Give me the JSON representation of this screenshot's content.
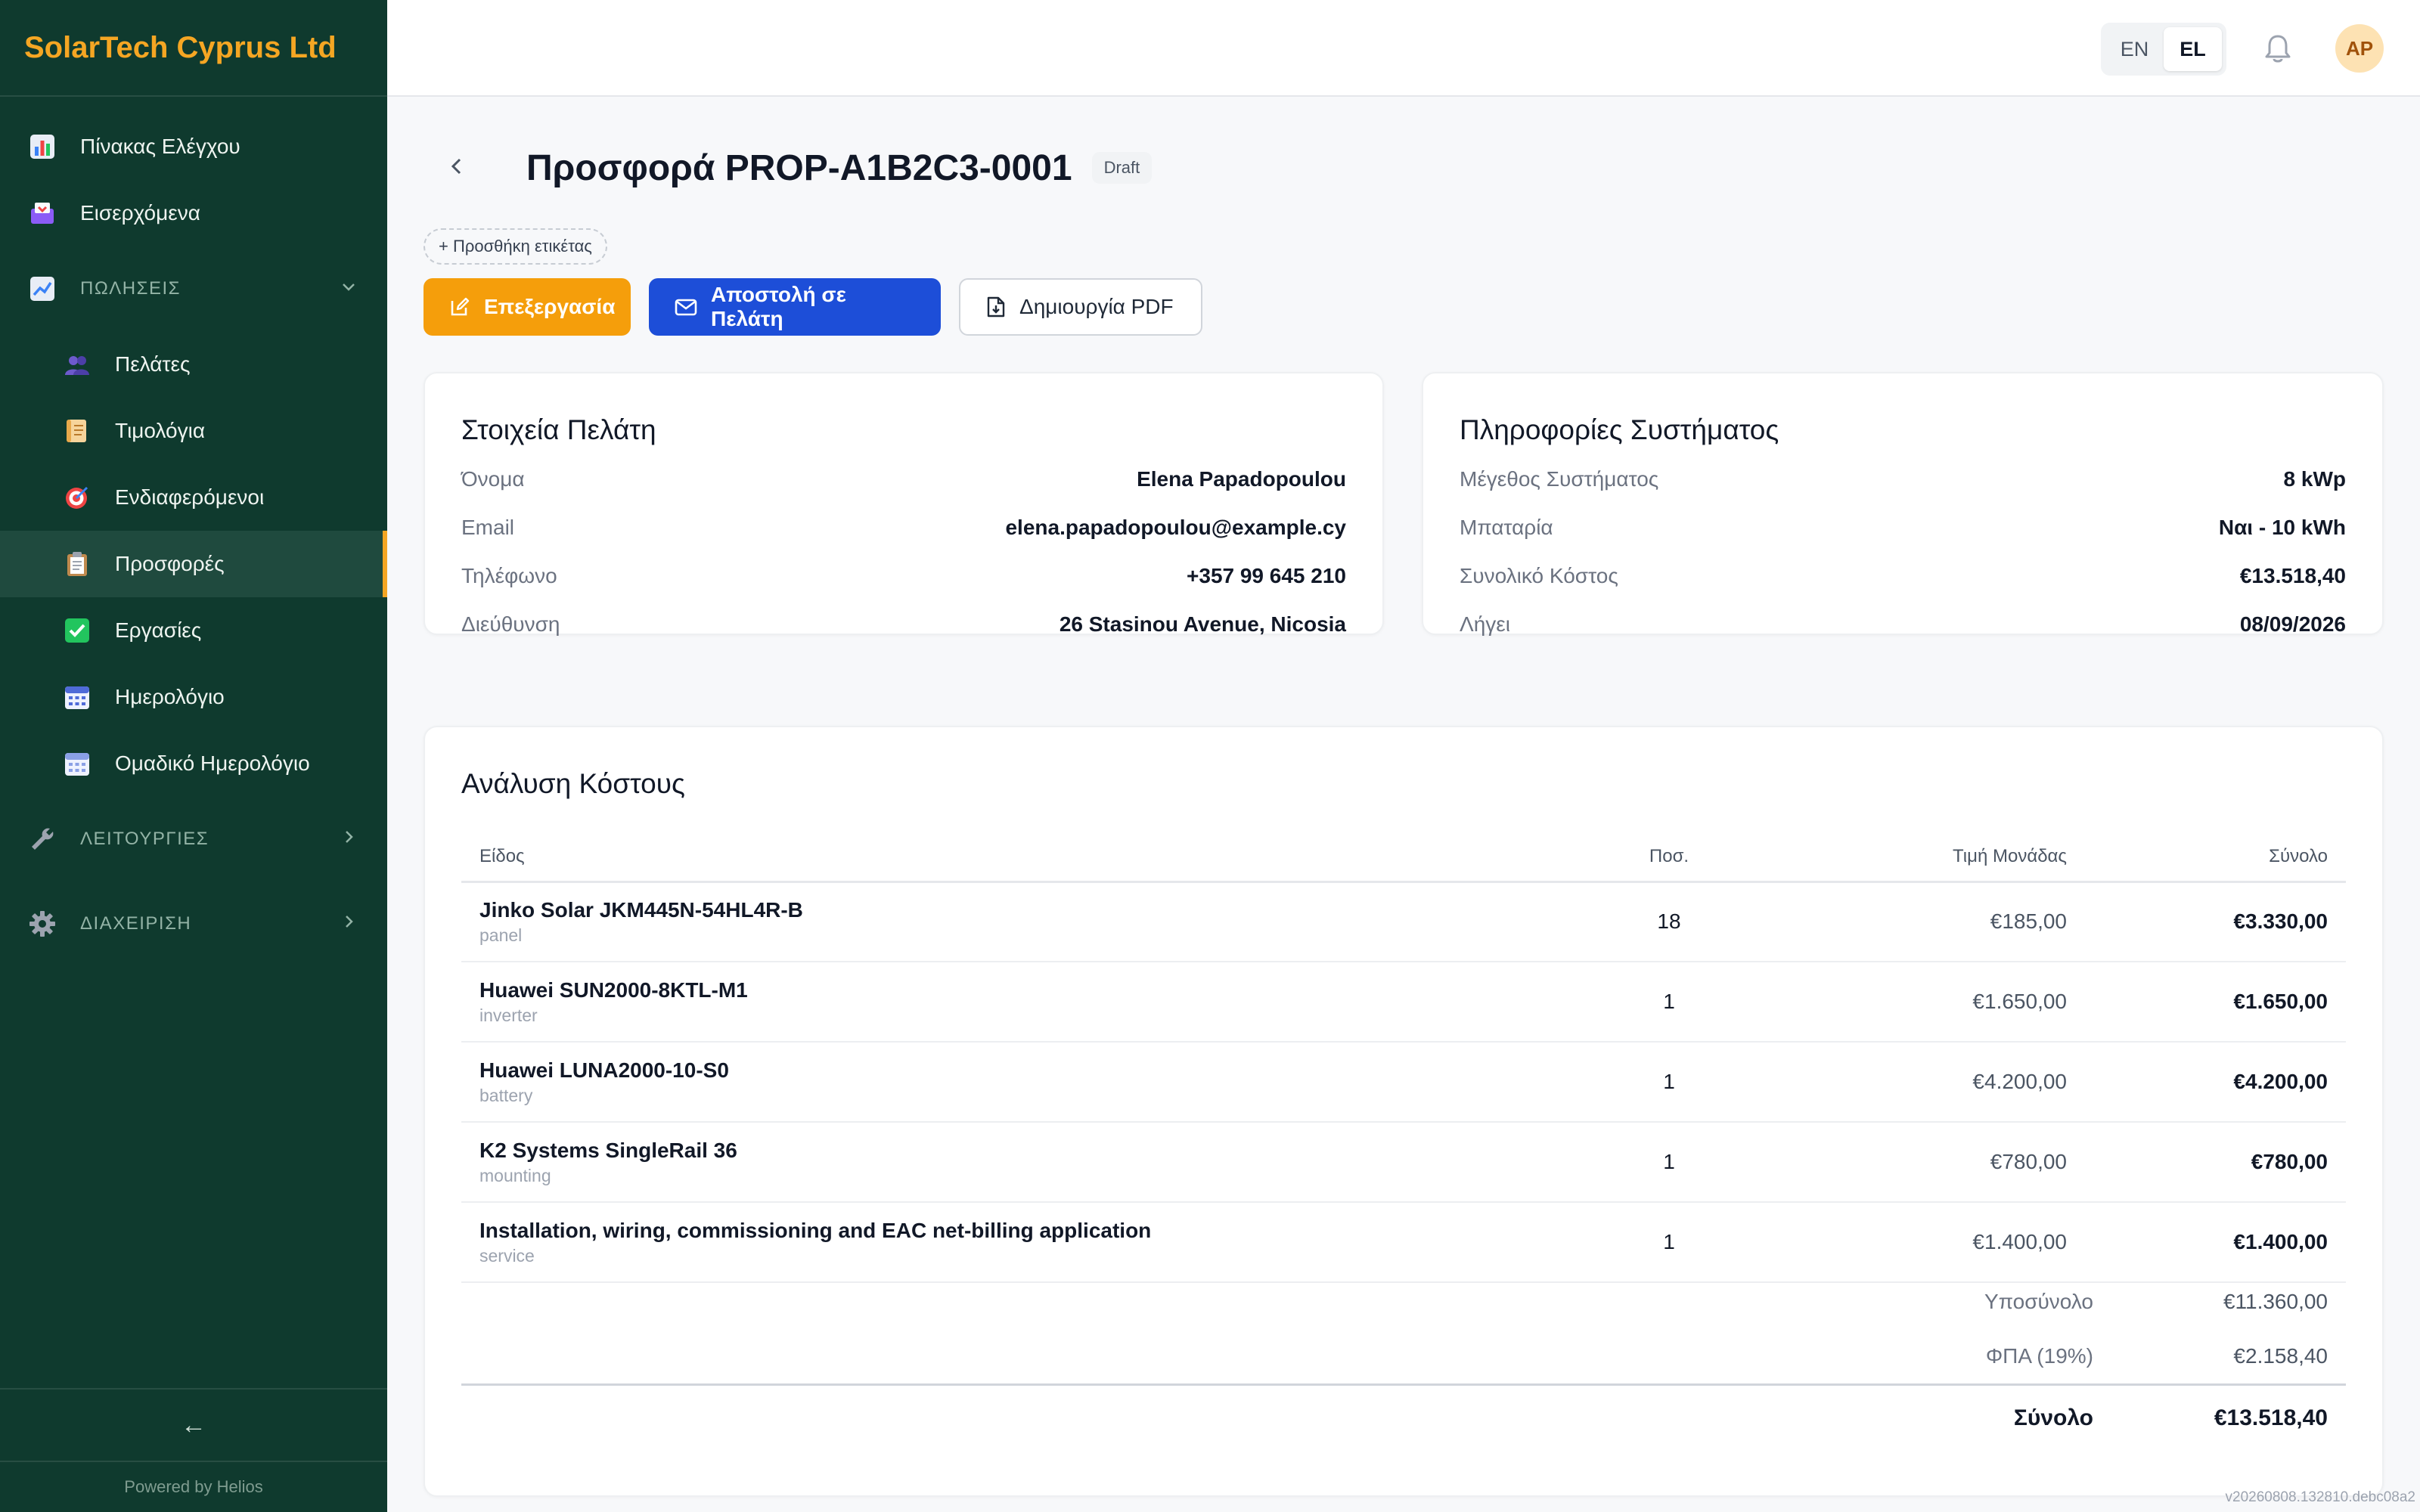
{
  "brand": {
    "name": "SolarTech Cyprus Ltd"
  },
  "sidebar": {
    "top_items": [
      {
        "label": "Πίνακας Ελέγχου",
        "icon": "bar-chart-icon"
      },
      {
        "label": "Εισερχόμενα",
        "icon": "inbox-icon"
      }
    ],
    "sales_section": {
      "label": "ΠΩΛΗΣΕΙΣ",
      "icon": "trending-up-icon",
      "expanded": true,
      "items": [
        {
          "label": "Πελάτες",
          "icon": "users-icon"
        },
        {
          "label": "Τιμολόγια",
          "icon": "scroll-icon"
        },
        {
          "label": "Ενδιαφερόμενοι",
          "icon": "target-icon"
        },
        {
          "label": "Προσφορές",
          "icon": "clipboard-icon",
          "active": true
        },
        {
          "label": "Εργασίες",
          "icon": "checkbox-icon"
        },
        {
          "label": "Ημερολόγιο",
          "icon": "calendar-icon"
        },
        {
          "label": "Ομαδικό Ημερολόγιο",
          "icon": "calendar-icon"
        }
      ]
    },
    "operations_section": {
      "label": "ΛΕΙΤΟΥΡΓΙΕΣ",
      "icon": "wrench-icon"
    },
    "admin_section": {
      "label": "ΔΙΑΧΕΙΡΙΣΗ",
      "icon": "gear-icon"
    },
    "collapse_glyph": "←",
    "powered_by": "Powered by Helios"
  },
  "topbar": {
    "languages": [
      "EN",
      "EL"
    ],
    "active_language": "EL",
    "avatar_initials": "AP"
  },
  "page": {
    "title": "Προσφορά PROP-A1B2C3-0001",
    "status": "Draft",
    "add_tag": "+ Προσθήκη ετικέτας",
    "actions": {
      "edit": "Επεξεργασία",
      "send": "Αποστολή σε Πελάτη",
      "pdf": "Δημιουργία PDF"
    }
  },
  "customer": {
    "title": "Στοιχεία Πελάτη",
    "rows": [
      {
        "label": "Όνομα",
        "value": "Elena Papadopoulou"
      },
      {
        "label": "Email",
        "value": "elena.papadopoulou@example.cy"
      },
      {
        "label": "Τηλέφωνο",
        "value": "+357 99 645 210"
      },
      {
        "label": "Διεύθυνση",
        "value": "26 Stasinou Avenue, Nicosia"
      }
    ]
  },
  "system": {
    "title": "Πληροφορίες Συστήματος",
    "rows": [
      {
        "label": "Μέγεθος Συστήματος",
        "value": "8 kWp"
      },
      {
        "label": "Μπαταρία",
        "value": "Ναι - 10 kWh"
      },
      {
        "label": "Συνολικό Κόστος",
        "value": "€13.518,40"
      },
      {
        "label": "Λήγει",
        "value": "08/09/2026"
      }
    ]
  },
  "cost": {
    "title": "Ανάλυση Κόστους",
    "columns": {
      "item": "Είδος",
      "qty": "Ποσ.",
      "unit_price": "Τιμή Μονάδας",
      "total": "Σύνολο"
    },
    "rows": [
      {
        "name": "Jinko Solar JKM445N-54HL4R-B",
        "type": "panel",
        "qty": "18",
        "unit_price": "€185,00",
        "total": "€3.330,00"
      },
      {
        "name": "Huawei SUN2000-8KTL-M1",
        "type": "inverter",
        "qty": "1",
        "unit_price": "€1.650,00",
        "total": "€1.650,00"
      },
      {
        "name": "Huawei LUNA2000-10-S0",
        "type": "battery",
        "qty": "1",
        "unit_price": "€4.200,00",
        "total": "€4.200,00"
      },
      {
        "name": "K2 Systems SingleRail 36",
        "type": "mounting",
        "qty": "1",
        "unit_price": "€780,00",
        "total": "€780,00"
      },
      {
        "name": "Installation, wiring, commissioning and EAC net-billing application",
        "type": "service",
        "qty": "1",
        "unit_price": "€1.400,00",
        "total": "€1.400,00"
      }
    ],
    "subtotal_label": "Υποσύνολο",
    "subtotal": "€11.360,00",
    "vat_label": "ΦΠΑ (19%)",
    "vat": "€2.158,40",
    "total_label": "Σύνολο",
    "total": "€13.518,40"
  },
  "version": "v20260808.132810.debc08a2",
  "colors": {
    "sidebar_bg": "#0f3a2e",
    "brand_accent": "#f5a623",
    "edit_button": "#f59e0b",
    "send_button": "#1d4ed8"
  }
}
